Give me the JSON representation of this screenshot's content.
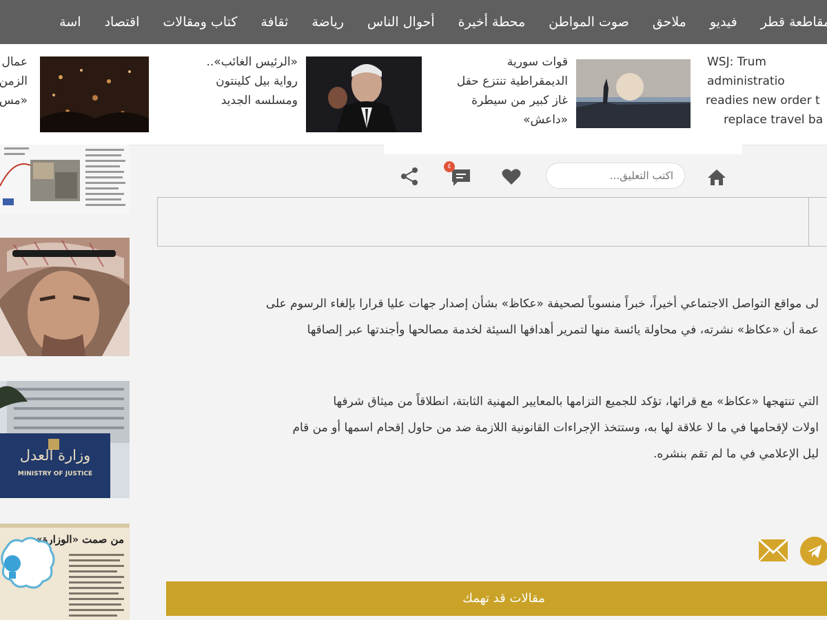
{
  "nav": {
    "items": [
      "اسة",
      "اقتصاد",
      "كتاب ومقالات",
      "ثقافة",
      "رياضة",
      "أحوال الناس",
      "محطة أخيرة",
      "صوت المواطن",
      "ملاحق",
      "فيديو",
      "مقاطعة قطر"
    ]
  },
  "ticker": {
    "item1": {
      "lines": [
        "WSJ: Trum",
        "administratio",
        "readies new order t",
        "replace travel ba"
      ]
    },
    "item2": {
      "lines": [
        "قوات سورية",
        "الديمقراطية تنتزع حقل",
        "غاز كبير من سيطرة",
        "«داعش»"
      ]
    },
    "item3": {
      "lines": [
        "«الرئيس الغائب»..",
        "رواية بيل كلينتون",
        "ومسلسه الجديد"
      ]
    },
    "item4": {
      "lines": [
        "عمال",
        "الزمن",
        "«مس"
      ]
    }
  },
  "actions": {
    "comment_placeholder": "اكتب التعليق...",
    "comment_badge": "٤"
  },
  "article": {
    "para1": [
      "لى مواقع التواصل الاجتماعي أخيراً، خبراً منسوباً لصحيفة «عكاظ» بشأن إصدار جهات عليا قرارا بإلغاء الرسوم على",
      "عمة أن «عكاظ» نشرته، في محاولة يائسة منها لتمرير أهدافها السيئة لخدمة مصالحها وأجندتها عبر إلصاقها"
    ],
    "para2": [
      "التي تنتهجها «عكاظ» مع قرائها، تؤكد للجميع التزامها بالمعايير المهنية الثابتة، انطلاقاً من ميثاق شرفها",
      "اولات لإقحامها في ما لا علاقة لها به، وستتخذ الإجراءات القانونية اللازمة ضد من حاول إقحام اسمها أو من قام",
      "ليل الإعلامي في ما لم تقم بنشره."
    ]
  },
  "sidebar": {
    "card3_sign": "وزارة العدل",
    "card3_sign_en": "MINISTRY OF JUSTICE",
    "card4_headline": "من صمت «الوزارة»"
  },
  "related_banner": "مقالات قد تهمك",
  "colors": {
    "nav_bg": "#5f5f5f",
    "accent": "#c9a227",
    "telegram": "#d4a52a"
  }
}
